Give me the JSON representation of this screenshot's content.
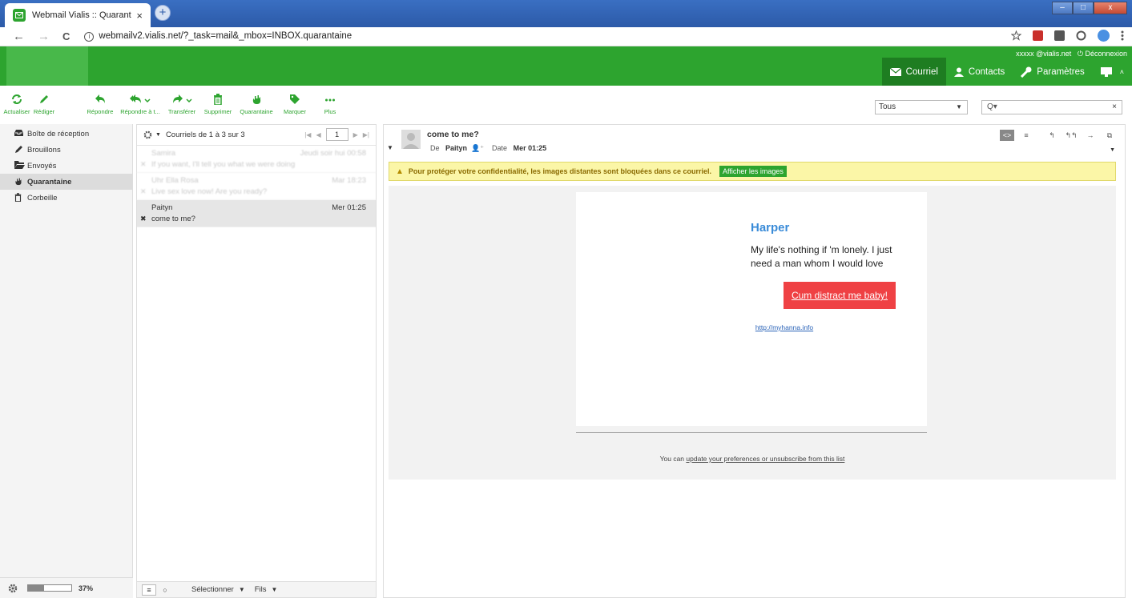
{
  "browser": {
    "tab_title": "Webmail Vialis :: Quarantaine",
    "tab_close": "×",
    "new_tab": "+",
    "url": "webmailv2.vialis.net/?_task=mail&_mbox=INBOX.quarantaine",
    "nav_back": "←",
    "nav_forward": "→",
    "nav_reload": "C",
    "url_info": "i"
  },
  "header": {
    "user": "xxxxx @vialis.net",
    "logout": "Déconnexion",
    "menu": [
      {
        "label": "Courriel",
        "icon": "envelope-icon",
        "active": true
      },
      {
        "label": "Contacts",
        "icon": "person-icon",
        "active": false
      },
      {
        "label": "Paramètres",
        "icon": "wrench-icon",
        "active": false
      }
    ]
  },
  "toolbar": {
    "buttons": [
      {
        "label": "Actualiser",
        "icon": "refresh-icon"
      },
      {
        "label": "Rédiger",
        "icon": "pencil-icon"
      },
      {
        "label": "Répondre",
        "icon": "reply-icon"
      },
      {
        "label": "Répondre à t...",
        "icon": "reply-all-icon"
      },
      {
        "label": "Transférer",
        "icon": "forward-icon"
      },
      {
        "label": "Supprimer",
        "icon": "trash-icon"
      },
      {
        "label": "Quarantaine",
        "icon": "hand-icon"
      },
      {
        "label": "Marquer",
        "icon": "tag-icon"
      },
      {
        "label": "Plus",
        "icon": "more-icon"
      }
    ],
    "filter_value": "Tous",
    "search_placeholder": "Q▾",
    "search_clear": "×"
  },
  "folders": {
    "items": [
      {
        "label": "Boîte de réception",
        "icon": "inbox-icon",
        "selected": false
      },
      {
        "label": "Brouillons",
        "icon": "pencil-icon",
        "selected": false
      },
      {
        "label": "Envoyés",
        "icon": "folder-icon",
        "selected": false
      },
      {
        "label": "Quarantaine",
        "icon": "hand-icon",
        "selected": true
      },
      {
        "label": "Corbeille",
        "icon": "trash-icon",
        "selected": false
      }
    ],
    "quota_pct": 37,
    "quota_text": "37%"
  },
  "message_list": {
    "count_text": "Courriels de 1 à 3 sur 3",
    "page": "1",
    "messages": [
      {
        "from": "Samira",
        "date": "Jeudi soir hui 00:58",
        "subject": "If you want, I'll tell you what we were doing",
        "blurred": true,
        "selected": false
      },
      {
        "from": "Uhr Ella Rosa",
        "date": "Mar 18:23",
        "subject": "Live sex love now! Are you ready?",
        "blurred": true,
        "selected": false
      },
      {
        "from": "Paityn",
        "date": "Mer 01:25",
        "subject": "come to me?",
        "blurred": false,
        "selected": true
      }
    ],
    "footer_select": "Sélectionner",
    "footer_threads": "Fils"
  },
  "preview": {
    "subject": "come to me?",
    "from_label": "De",
    "from": "Paityn",
    "date_label": "Date",
    "date": "Mer 01:25",
    "warning": "Pour protéger votre confidentialité, les images distantes sont bloquées dans ce courriel.",
    "show_images": "Afficher les images",
    "body": {
      "name": "Harper",
      "text": "My life's nothing if 'm lonely. I just need a man whom I would love",
      "cta": "Cum distract me baby!",
      "link": "http://myhanna.info",
      "footer_prefix": "You can ",
      "footer_link": "update your preferences or unsubscribe from this list"
    }
  },
  "colors": {
    "brand_green": "#2da42f",
    "active_green": "#1e7d21",
    "cta_red": "#ef4144",
    "link_blue": "#2a63b8",
    "warning_bg": "#fbf6a7"
  }
}
